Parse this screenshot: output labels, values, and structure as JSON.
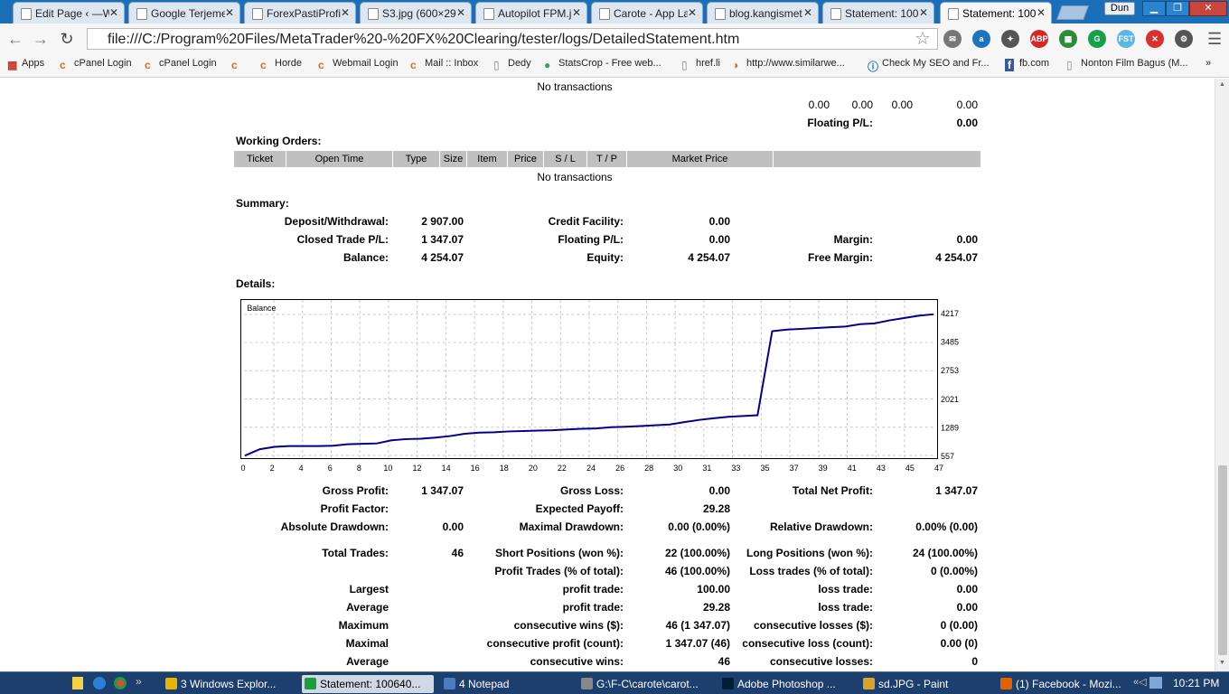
{
  "browser": {
    "tabs": [
      {
        "label": "Edit Page ‹ —W",
        "active": false
      },
      {
        "label": "Google Terjeme",
        "active": false
      },
      {
        "label": "ForexPastiProfi",
        "active": false
      },
      {
        "label": "S3.jpg (600×29",
        "active": false
      },
      {
        "label": "Autopilot FPM.jp",
        "active": false
      },
      {
        "label": "Carote - App La",
        "active": false
      },
      {
        "label": "blog.kangismet",
        "active": false
      },
      {
        "label": "Statement: 100",
        "active": false
      },
      {
        "label": "Statement: 100(",
        "active": true
      }
    ],
    "user_label": "Dun",
    "url": "file:///C:/Program%20Files/MetaTrader%20-%20FX%20Clearing/tester/logs/DetailedStatement.htm",
    "extensions": [
      {
        "label": "✉",
        "color": "#777777"
      },
      {
        "label": "a",
        "color": "#1e73be"
      },
      {
        "label": "✦",
        "color": "#555555"
      },
      {
        "label": "ABP",
        "color": "#d22828"
      },
      {
        "label": "▦",
        "color": "#2e8b3a"
      },
      {
        "label": "G",
        "color": "#15a049"
      },
      {
        "label": "FST",
        "color": "#5bb7e6"
      },
      {
        "label": "✕",
        "color": "#d93030"
      },
      {
        "label": "⚙",
        "color": "#555555"
      }
    ],
    "bookmarks": [
      {
        "label": "Apps",
        "icon": "apps-icon"
      },
      {
        "label": "cPanel Login",
        "icon": "cpanel-icon"
      },
      {
        "label": "cPanel Login",
        "icon": "cpanel-icon"
      },
      {
        "label": "",
        "icon": "cpanel-icon"
      },
      {
        "label": "Horde",
        "icon": "cpanel-icon"
      },
      {
        "label": "Webmail Login",
        "icon": "cpanel-icon"
      },
      {
        "label": "Mail :: Inbox",
        "icon": "cpanel-icon"
      },
      {
        "label": "Dedy",
        "icon": "page-icon"
      },
      {
        "label": "StatsCrop - Free web...",
        "icon": "statscrop-icon"
      },
      {
        "label": "href.li",
        "icon": "page-icon"
      },
      {
        "label": "http://www.similarwe...",
        "icon": "similarweb-icon"
      },
      {
        "label": "Check My SEO and Fr...",
        "icon": "info-icon"
      },
      {
        "label": "fb.com",
        "icon": "facebook-icon"
      },
      {
        "label": "Nonton Film Bagus (M...",
        "icon": "page-icon"
      }
    ],
    "bookmarks_more": "»"
  },
  "report": {
    "top_no_transactions": "No transactions",
    "top_row_values": [
      "0.00",
      "0.00",
      "0.00",
      "0.00"
    ],
    "top_floating_label": "Floating P/L:",
    "top_floating_value": "0.00",
    "working_orders_title": "Working Orders:",
    "working_orders_columns": [
      "Ticket",
      "Open Time",
      "Type",
      "Size",
      "Item",
      "Price",
      "S / L",
      "T / P",
      "Market Price",
      ""
    ],
    "working_orders_empty": "No transactions",
    "summary_title": "Summary:",
    "summary": {
      "deposit_label": "Deposit/Withdrawal:",
      "deposit_value": "2 907.00",
      "credit_label": "Credit Facility:",
      "credit_value": "0.00",
      "closed_label": "Closed Trade P/L:",
      "closed_value": "1 347.07",
      "floating_label": "Floating P/L:",
      "floating_value": "0.00",
      "margin_label": "Margin:",
      "margin_value": "0.00",
      "balance_label": "Balance:",
      "balance_value": "4 254.07",
      "equity_label": "Equity:",
      "equity_value": "4 254.07",
      "free_margin_label": "Free Margin:",
      "free_margin_value": "4 254.07"
    },
    "details_title": "Details:",
    "stats": [
      [
        "Gross Profit:",
        "1 347.07",
        "Gross Loss:",
        "0.00",
        "Total Net Profit:",
        "1 347.07"
      ],
      [
        "Profit Factor:",
        "",
        "Expected Payoff:",
        "29.28",
        "",
        ""
      ],
      [
        "Absolute Drawdown:",
        "0.00",
        "Maximal Drawdown:",
        "0.00 (0.00%)",
        "Relative Drawdown:",
        "0.00% (0.00)"
      ],
      [
        "Total Trades:",
        "46",
        "Short Positions (won %):",
        "22 (100.00%)",
        "Long Positions (won %):",
        "24 (100.00%)"
      ],
      [
        "",
        "",
        "Profit Trades (% of total):",
        "46 (100.00%)",
        "Loss trades (% of total):",
        "0 (0.00%)"
      ],
      [
        "Largest",
        "",
        "profit trade:",
        "100.00",
        "loss trade:",
        "0.00"
      ],
      [
        "Average",
        "",
        "profit trade:",
        "29.28",
        "loss trade:",
        "0.00"
      ],
      [
        "Maximum",
        "",
        "consecutive wins ($):",
        "46 (1 347.07)",
        "consecutive losses ($):",
        "0 (0.00)"
      ],
      [
        "Maximal",
        "",
        "consecutive profit (count):",
        "1 347.07 (46)",
        "consecutive loss (count):",
        "0.00 (0)"
      ],
      [
        "Average",
        "",
        "consecutive wins:",
        "46",
        "consecutive losses:",
        "0"
      ]
    ]
  },
  "chart_data": {
    "type": "line",
    "title": "Balance",
    "x_ticks": [
      "0",
      "2",
      "4",
      "6",
      "8",
      "10",
      "12",
      "14",
      "16",
      "18",
      "20",
      "22",
      "24",
      "26",
      "28",
      "30",
      "31",
      "33",
      "35",
      "37",
      "39",
      "41",
      "43",
      "45",
      "47"
    ],
    "y_ticks": [
      "4217",
      "3485",
      "2753",
      "2021",
      "1289",
      "557"
    ],
    "ylim": [
      557,
      4217
    ],
    "xlim": [
      0,
      47
    ],
    "grid": true,
    "series": [
      {
        "color": "#00008b",
        "x": [
          0,
          1,
          2,
          3,
          4,
          5,
          6,
          7,
          8,
          9,
          10,
          11,
          12,
          13,
          14,
          15,
          16,
          17,
          18,
          19,
          20,
          21,
          22,
          23,
          24,
          25,
          26,
          27,
          28,
          29,
          30,
          31,
          32,
          33,
          34,
          35,
          36,
          37,
          38,
          39,
          40,
          41,
          42,
          43,
          44,
          45,
          46,
          47
        ],
        "y": [
          557,
          720,
          780,
          800,
          800,
          800,
          810,
          850,
          860,
          870,
          950,
          980,
          990,
          1020,
          1060,
          1120,
          1150,
          1160,
          1180,
          1190,
          1200,
          1210,
          1230,
          1250,
          1260,
          1290,
          1300,
          1320,
          1340,
          1360,
          1420,
          1480,
          1520,
          1560,
          1580,
          1600,
          3780,
          3820,
          3840,
          3860,
          3880,
          3900,
          3960,
          3980,
          4060,
          4120,
          4180,
          4217
        ]
      }
    ]
  },
  "taskbar": {
    "start_icon": "apple-start-icon",
    "items": [
      {
        "label": "3 Windows Explor...",
        "color": "#e8b400",
        "active": false
      },
      {
        "label": "Statement: 100640...",
        "color": "#1b9e3e",
        "active": true
      },
      {
        "label": "4 Notepad",
        "color": "#4a7cc0",
        "active": false
      },
      {
        "label": "G:\\F-C\\carote\\carot...",
        "color": "#888888",
        "active": false
      },
      {
        "label": "Adobe Photoshop ...",
        "color": "#001e36",
        "active": false
      },
      {
        "label": "sd.JPG - Paint",
        "color": "#d9a42b",
        "active": false
      },
      {
        "label": "(1) Facebook - Mozi...",
        "color": "#e66000",
        "active": false
      }
    ],
    "clock": "10:21 PM"
  }
}
